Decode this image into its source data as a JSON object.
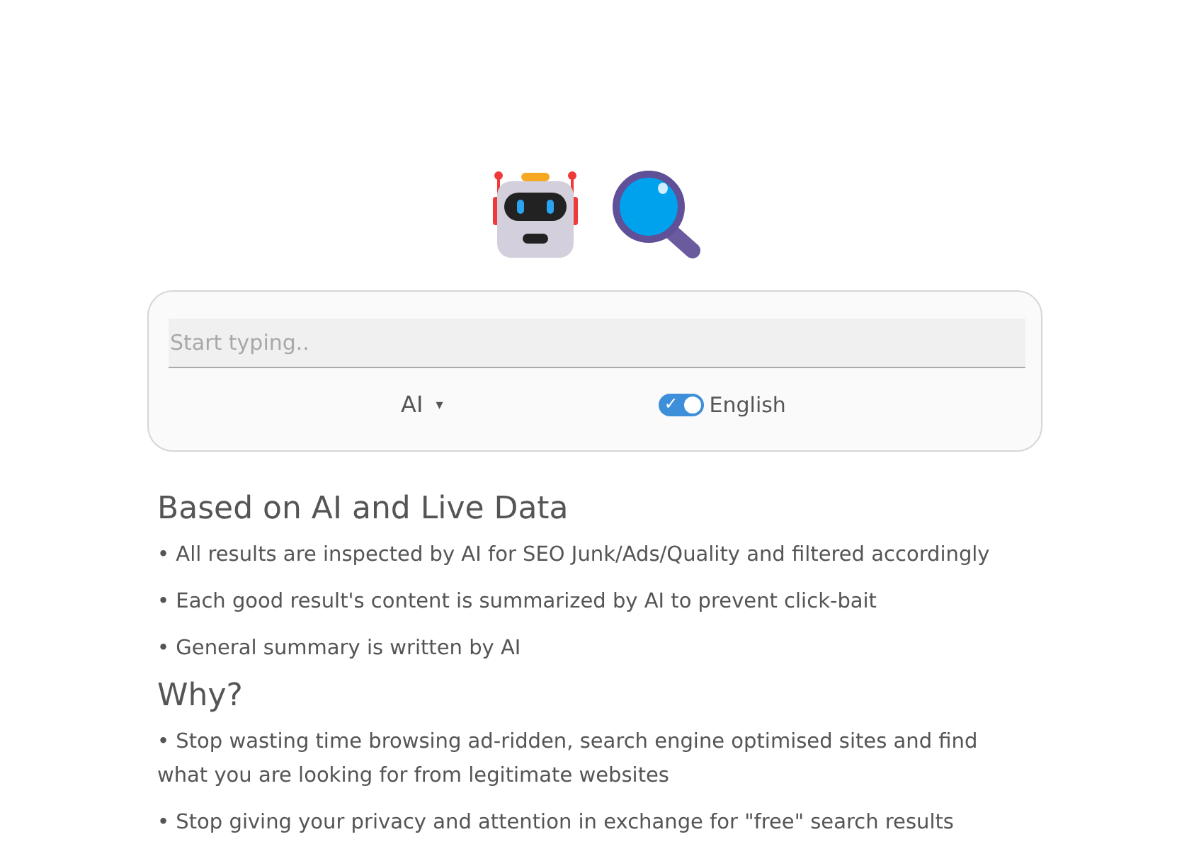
{
  "search": {
    "placeholder": "Start typing..",
    "mode": "AI",
    "mode_caret": "▾",
    "language_toggle": {
      "on": true,
      "check": "✓",
      "label": "English"
    }
  },
  "sections": [
    {
      "heading": "Based on AI and Live Data",
      "items": [
        "• All results are inspected by AI for SEO Junk/Ads/Quality and filtered accordingly",
        "• Each good result's content is summarized by AI to prevent click-bait",
        "• General summary is written by AI"
      ]
    },
    {
      "heading": "Why?",
      "items": [
        "• Stop wasting time browsing ad-ridden, search engine optimised sites and find what you are looking for from legitimate websites",
        "• Stop giving your privacy and attention in exchange for \"free\" search results"
      ]
    }
  ]
}
